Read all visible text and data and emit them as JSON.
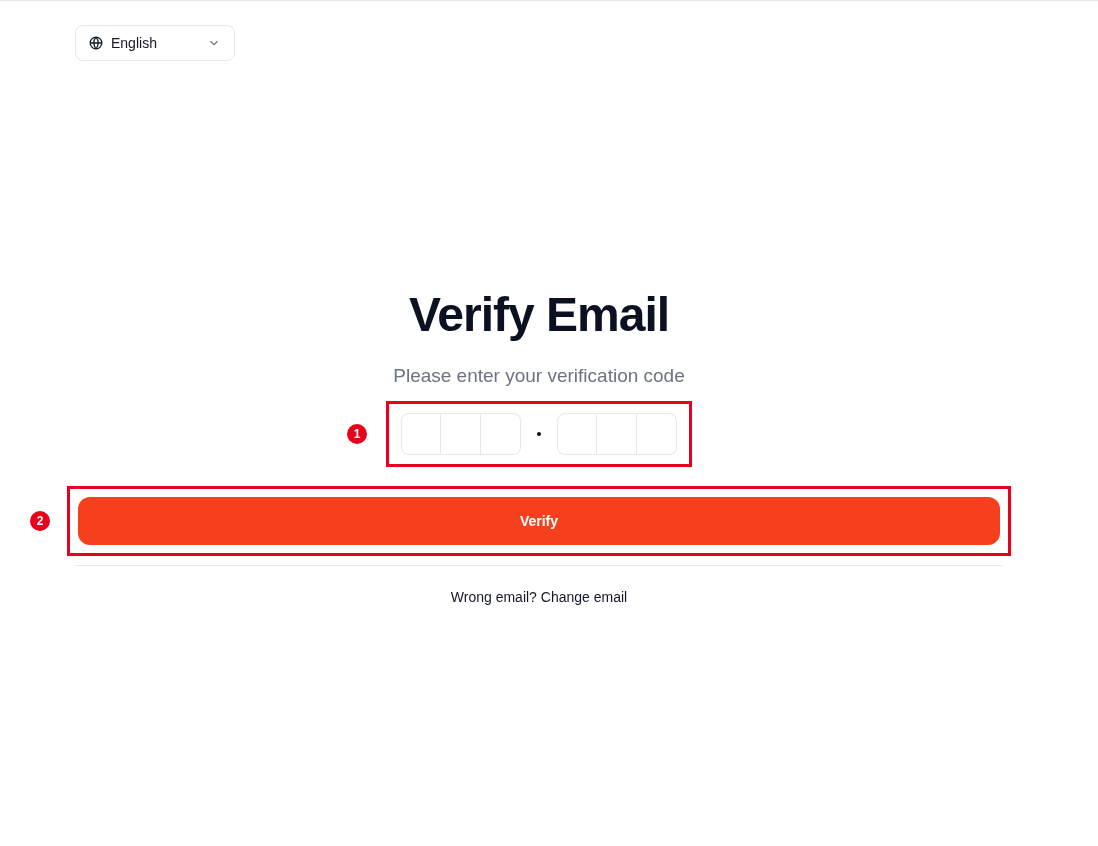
{
  "language_select": {
    "value": "English"
  },
  "title": "Verify Email",
  "subtitle": "Please enter your verification code",
  "verify_button": "Verify",
  "change_email_link": "Wrong email? Change email",
  "annotations": [
    {
      "label": "1"
    },
    {
      "label": "2"
    }
  ]
}
